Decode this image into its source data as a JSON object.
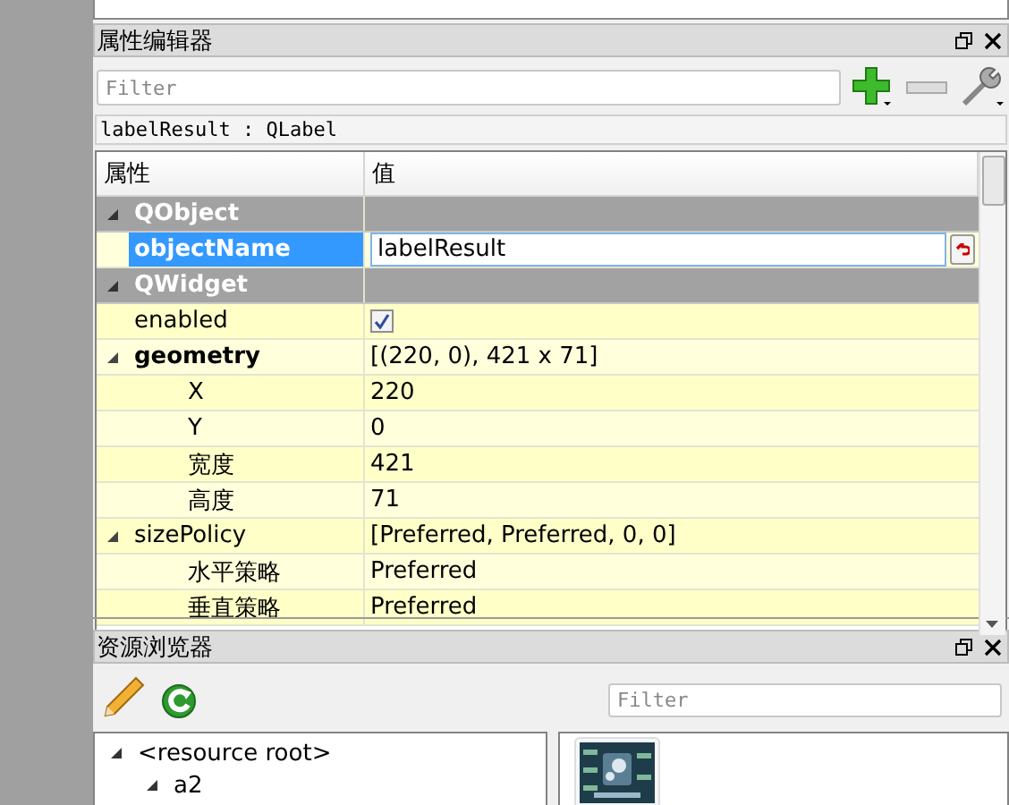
{
  "property_editor": {
    "title": "属性编辑器",
    "filter_placeholder": "Filter",
    "object_label": "labelResult : QLabel",
    "columns": [
      "属性",
      "值"
    ],
    "rows": [
      {
        "kind": "group",
        "name": "QObject",
        "expanded": true,
        "children": [
          {
            "kind": "edit",
            "name": "objectName",
            "value": "labelResult",
            "modified": true,
            "selected": true
          }
        ]
      },
      {
        "kind": "group",
        "name": "QWidget",
        "expanded": true,
        "children": [
          {
            "kind": "check",
            "name": "enabled",
            "checked": true,
            "modified": false,
            "selected": false
          },
          {
            "kind": "text",
            "name": "geometry",
            "value": "[(220, 0), 421 x 71]",
            "modified": true,
            "selected": false,
            "expanded": true,
            "children": [
              {
                "kind": "text",
                "name": "X",
                "value": "220",
                "modified": false,
                "selected": false
              },
              {
                "kind": "text",
                "name": "Y",
                "value": "0",
                "modified": false,
                "selected": false
              },
              {
                "kind": "text",
                "name": "宽度",
                "value": "421",
                "modified": false,
                "selected": false
              },
              {
                "kind": "text",
                "name": "高度",
                "value": "71",
                "modified": false,
                "selected": false
              }
            ]
          },
          {
            "kind": "text",
            "name": "sizePolicy",
            "value": "[Preferred, Preferred, 0, 0]",
            "modified": false,
            "selected": false,
            "expanded": true,
            "children": [
              {
                "kind": "text",
                "name": "水平策略",
                "value": "Preferred",
                "modified": false,
                "selected": false
              },
              {
                "kind": "text",
                "name": "垂直策略",
                "value": "Preferred",
                "modified": false,
                "selected": false
              }
            ]
          }
        ]
      }
    ]
  },
  "resource_browser": {
    "title": "资源浏览器",
    "filter_placeholder": "Filter",
    "tree": [
      {
        "label": "<resource root>",
        "expanded": true,
        "children": [
          {
            "label": "a2",
            "expanded": true
          }
        ]
      }
    ]
  }
}
